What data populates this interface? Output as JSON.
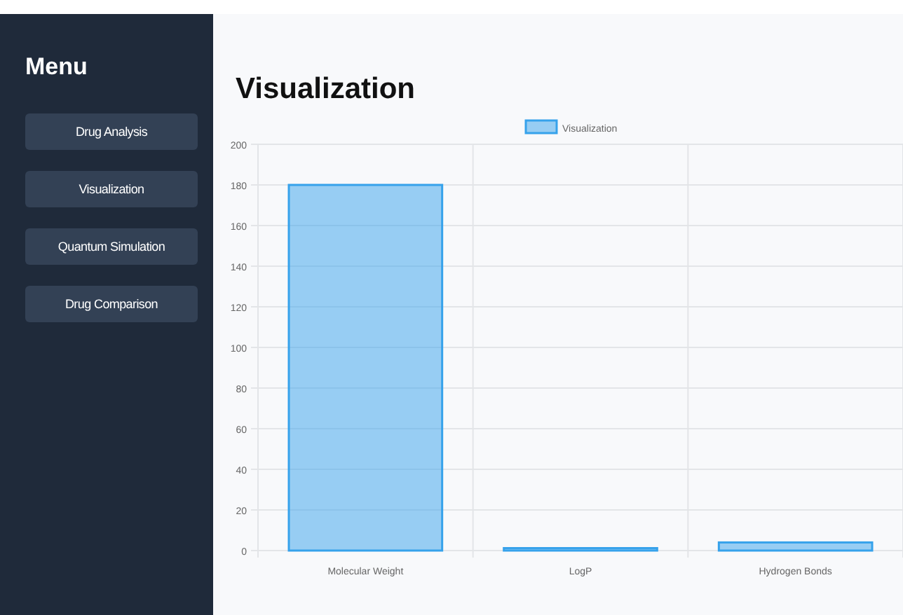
{
  "sidebar": {
    "title": "Menu",
    "items": [
      {
        "label": "Drug Analysis"
      },
      {
        "label": "Visualization"
      },
      {
        "label": "Quantum Simulation"
      },
      {
        "label": "Drug Comparison"
      }
    ]
  },
  "main": {
    "title": "Visualization",
    "chart_data": {
      "type": "bar",
      "categories": [
        "Molecular Weight",
        "LogP",
        "Hydrogen Bonds"
      ],
      "series": [
        {
          "name": "Visualization",
          "color": "#36a2eb",
          "values": [
            180,
            1.2,
            4
          ]
        }
      ],
      "ylim": [
        0,
        200
      ],
      "grid": true,
      "yticks": [
        0,
        20,
        40,
        60,
        80,
        100,
        120,
        140,
        160,
        180,
        200
      ]
    }
  }
}
